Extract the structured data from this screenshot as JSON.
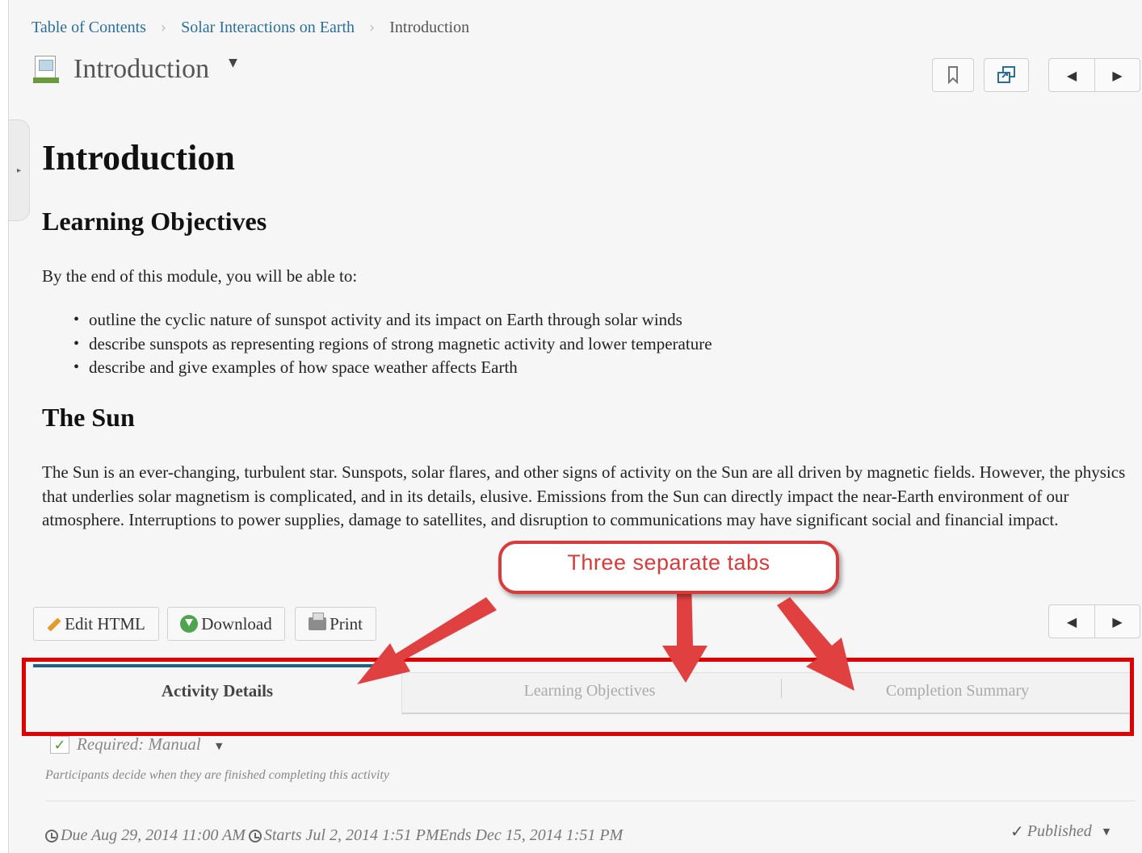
{
  "breadcrumb": {
    "items": [
      "Table of Contents",
      "Solar Interactions on Earth"
    ],
    "current": "Introduction"
  },
  "topic": {
    "title": "Introduction"
  },
  "content": {
    "heading": "Introduction",
    "objectives_heading": "Learning Objectives",
    "intro_text": "By the end of this module, you will be able to:",
    "objectives": [
      "outline the cyclic nature of sunspot activity and its impact on Earth through solar winds",
      "describe sunspots as representing regions of strong magnetic activity and lower temperature",
      "describe and give examples of how space weather affects Earth"
    ],
    "sun_heading": "The Sun",
    "sun_paragraph": "The Sun is an ever-changing, turbulent star. Sunspots, solar flares, and other signs of activity on the Sun are all driven by magnetic fields. However, the physics that underlies solar magnetism is complicated, and in its details, elusive. Emissions from the Sun can directly impact the near-Earth environment of our atmosphere. Interruptions to power supplies, damage to satellites, and disruption to communications may have significant social and financial impact."
  },
  "actions": {
    "edit_html": "Edit HTML",
    "download": "Download",
    "print": "Print"
  },
  "tabs": [
    {
      "label": "Activity Details",
      "active": true
    },
    {
      "label": "Learning Objectives",
      "active": false
    },
    {
      "label": "Completion Summary",
      "active": false
    }
  ],
  "details": {
    "required": "Required: Manual",
    "description": "Participants decide when they are finished completing this activity",
    "due": "Due Aug 29, 2014 11:00 AM",
    "starts_ends": "Starts Jul 2, 2014 1:51 PMEnds Dec 15, 2014 1:51 PM",
    "status": "Published"
  },
  "annotation": {
    "callout": "Three separate tabs"
  },
  "colors": {
    "annotation_red": "#e00000",
    "link_blue": "#2a6f9b",
    "active_tab_border": "#1e5f8a"
  }
}
